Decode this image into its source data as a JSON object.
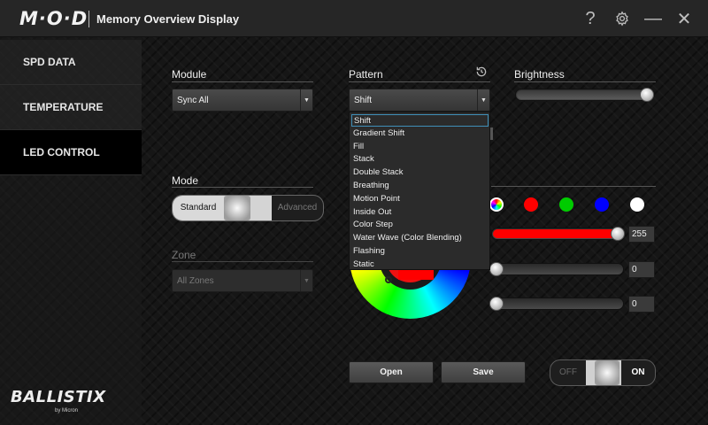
{
  "titlebar": {
    "logo": "M·O·D",
    "title": "Memory Overview Display",
    "help_icon": "?",
    "settings_icon": "gear-icon",
    "minimize_icon": "—",
    "close_icon": "✕"
  },
  "sidebar": {
    "items": [
      {
        "label": "SPD DATA"
      },
      {
        "label": "TEMPERATURE"
      },
      {
        "label": "LED CONTROL"
      }
    ],
    "brand": "BALLISTIX",
    "brand_sub": "by Micron"
  },
  "module": {
    "label": "Module",
    "value": "Sync All"
  },
  "pattern": {
    "label": "Pattern",
    "value": "Shift",
    "options": [
      "Shift",
      "Gradient Shift",
      "Fill",
      "Stack",
      "Double Stack",
      "Breathing",
      "Motion Point",
      "Inside Out",
      "Color Step",
      "Water Wave (Color Blending)",
      "Flashing",
      "Static"
    ],
    "selected_option": "Shift"
  },
  "brightness": {
    "label": "Brightness",
    "level": 1.0
  },
  "mode": {
    "label": "Mode",
    "left": "Standard",
    "right": "Advanced"
  },
  "zone": {
    "label": "Zone",
    "value": "All Zones"
  },
  "colors": {
    "swatches": [
      "#ff0000",
      "#00cc00",
      "#0000ff",
      "#ffffff"
    ],
    "red": {
      "value": "255",
      "color": "#ff0000"
    },
    "green": {
      "value": "0"
    },
    "blue": {
      "value": "0"
    }
  },
  "buttons": {
    "open": "Open",
    "save": "Save"
  },
  "power": {
    "off": "OFF",
    "on": "ON"
  }
}
